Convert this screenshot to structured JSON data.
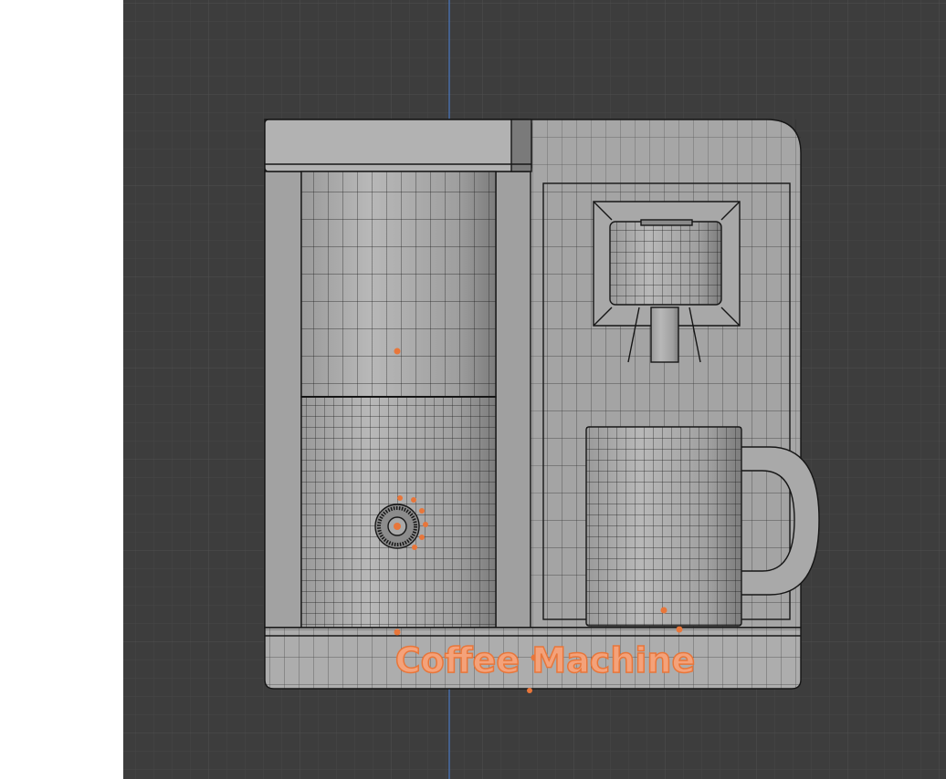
{
  "viewport": {
    "object_label": "Coffee Machine",
    "colors": {
      "background": "#3d3d3d",
      "grid_minor": "#474747",
      "grid_major": "#505050",
      "axis": "#4a78c0",
      "mesh_fill": "#a9a9a9",
      "mesh_shade": "#8f8f8f",
      "wire": "#161616",
      "selection": "#e8763a",
      "label_fill": "#f4a27a"
    },
    "icons": {
      "origin": "object-origin-icon",
      "dial": "dial-knob-icon"
    }
  }
}
